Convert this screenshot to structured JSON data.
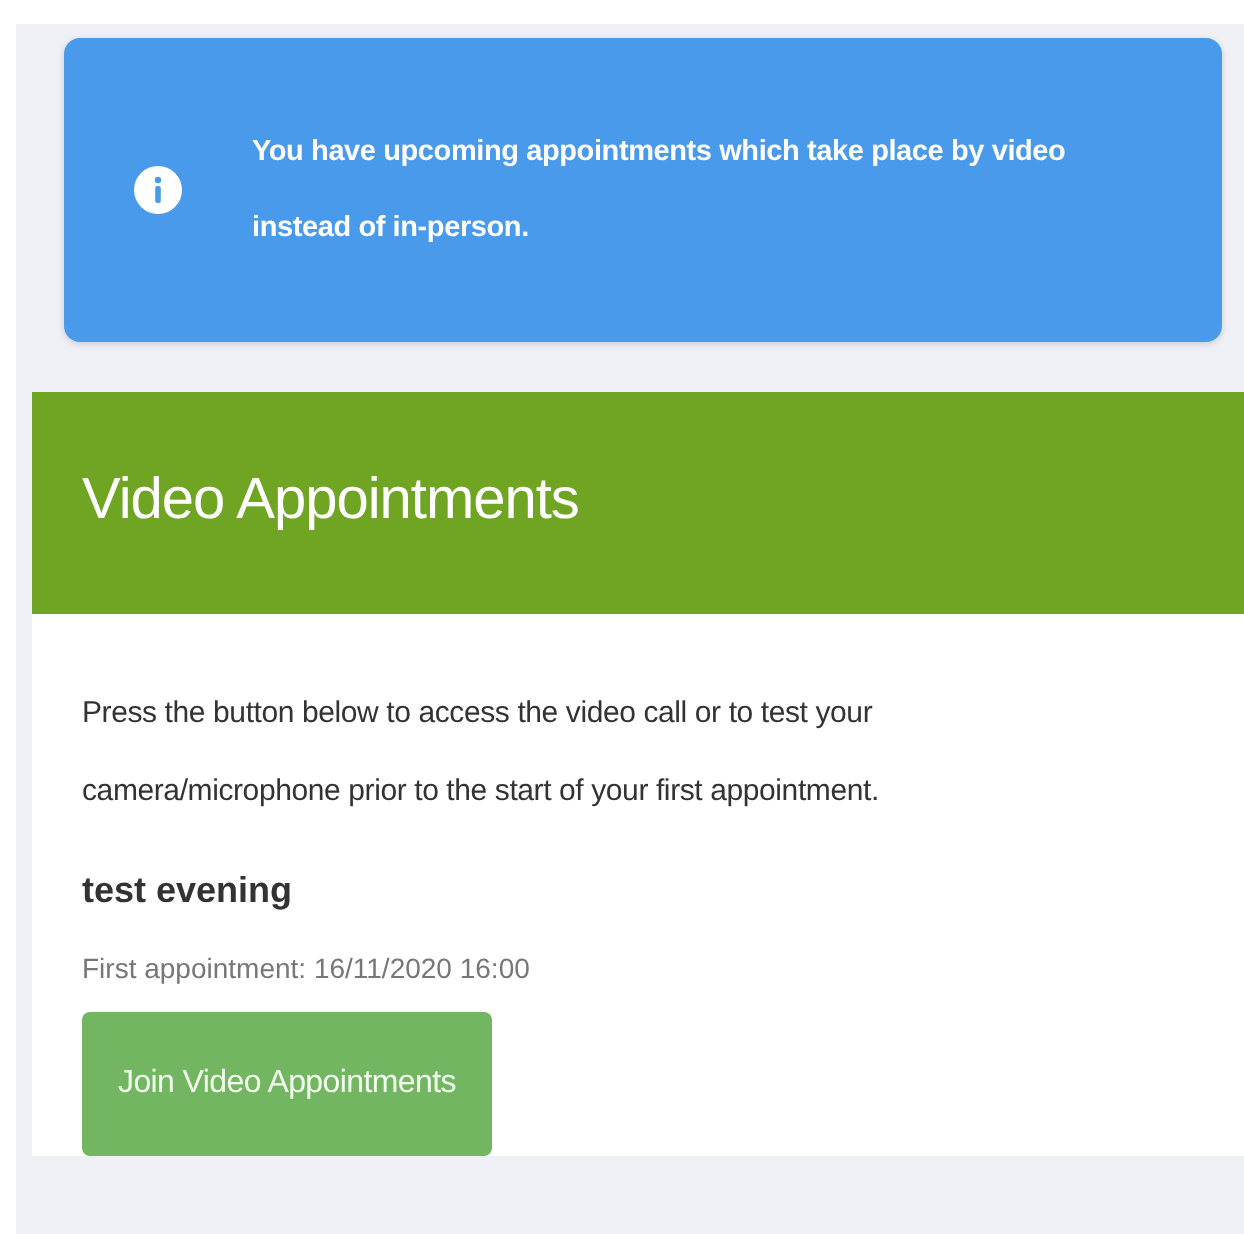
{
  "alert": {
    "kind": "info",
    "message": "You have upcoming appointments which take place by video instead of in-person."
  },
  "card": {
    "title": "Video Appointments",
    "intro": "Press the button below to access the video call or to test your camera/microphone prior to the start of your first appointment.",
    "appointment": {
      "name": "test evening",
      "first": "First appointment: 16/11/2020 16:00"
    },
    "button": "Join Video Appointments"
  }
}
